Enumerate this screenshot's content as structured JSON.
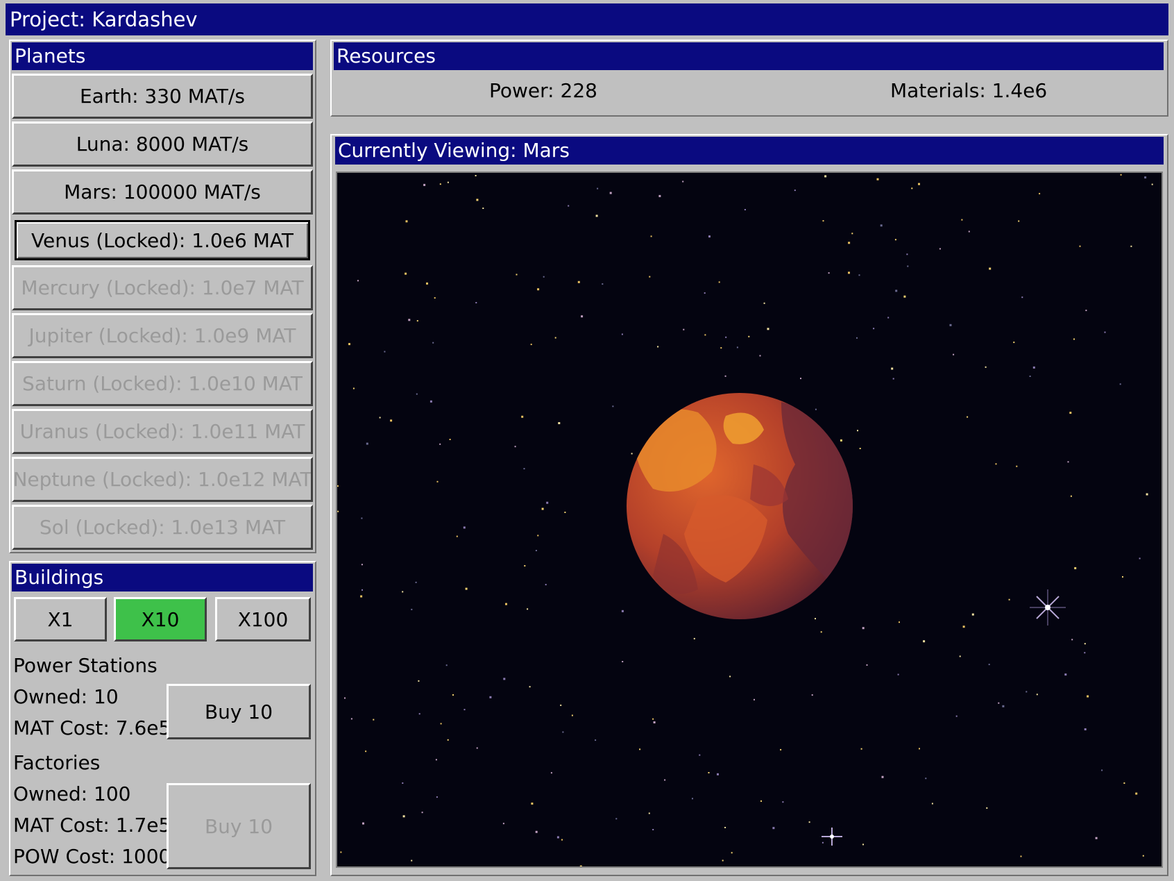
{
  "window": {
    "title": "Project: Kardashev"
  },
  "planets": {
    "header": "Planets",
    "items": [
      {
        "label": "Earth: 330 MAT/s",
        "state": "unlocked"
      },
      {
        "label": "Luna: 8000 MAT/s",
        "state": "unlocked"
      },
      {
        "label": "Mars: 100000 MAT/s",
        "state": "unlocked"
      },
      {
        "label": "Venus (Locked): 1.0e6 MAT",
        "state": "selected"
      },
      {
        "label": "Mercury (Locked): 1.0e7 MAT",
        "state": "disabled"
      },
      {
        "label": "Jupiter (Locked): 1.0e9 MAT",
        "state": "disabled"
      },
      {
        "label": "Saturn (Locked): 1.0e10 MAT",
        "state": "disabled"
      },
      {
        "label": "Uranus (Locked): 1.0e11 MAT",
        "state": "disabled"
      },
      {
        "label": "Neptune (Locked): 1.0e12 MAT",
        "state": "disabled"
      },
      {
        "label": "Sol (Locked): 1.0e13 MAT",
        "state": "disabled"
      }
    ]
  },
  "buildings": {
    "header": "Buildings",
    "multipliers": [
      "X1",
      "X10",
      "X100"
    ],
    "active_multiplier": "X10",
    "active_color": "#3ec14a",
    "power_stations": {
      "name": "Power Stations",
      "owned": "Owned: 10",
      "mat_cost": "MAT Cost: 7.6e5",
      "buy_label": "Buy 10"
    },
    "factories": {
      "name": "Factories",
      "owned": "Owned: 100",
      "mat_cost": "MAT Cost: 1.7e5",
      "pow_cost": "POW Cost: 1000",
      "buy_label": "Buy 10"
    }
  },
  "resources": {
    "header": "Resources",
    "power": "Power: 228",
    "materials": "Materials: 1.4e6"
  },
  "viewer": {
    "header": "Currently Viewing: Mars",
    "planet": "mars",
    "planet_color": "#c0442a"
  },
  "colors": {
    "title_bar": "#0a0a80",
    "panel_bg": "#c0c0c0",
    "space_bg": "#040410"
  }
}
